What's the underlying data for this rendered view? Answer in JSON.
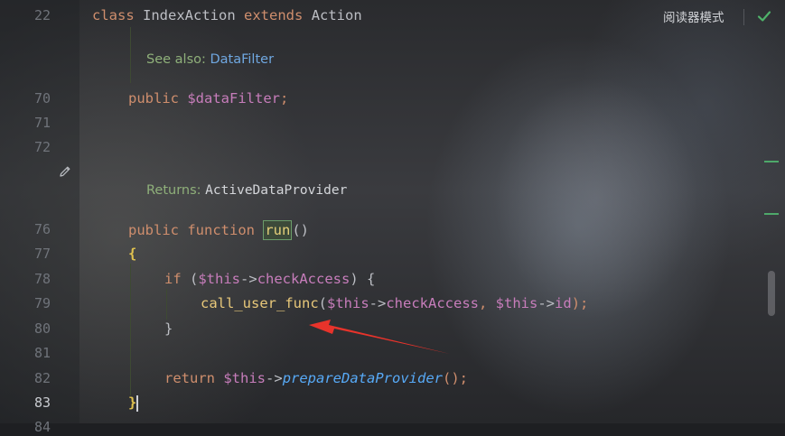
{
  "toolbar": {
    "reader_mode_label": "阅读器模式",
    "check_icon": "check-icon"
  },
  "editor": {
    "lines": {
      "l22": {
        "num": "22",
        "kw1": "class",
        "name": "IndexAction",
        "kw2": "extends",
        "parent": "Action"
      },
      "doc_see": {
        "label": "See also:",
        "link": "DataFilter"
      },
      "l70": {
        "num": "70",
        "kw": "public",
        "var": "$dataFilter",
        "semi": ";"
      },
      "l71": {
        "num": "71"
      },
      "l72": {
        "num": "72"
      },
      "doc_returns": {
        "label": "Returns:",
        "type": "ActiveDataProvider"
      },
      "l76": {
        "num": "76",
        "kw1": "public",
        "kw2": "function",
        "fn": "run",
        "parens": "()"
      },
      "l77": {
        "num": "77",
        "brace": "{"
      },
      "l78": {
        "num": "78",
        "kw": "if",
        "open": " (",
        "var": "$this",
        "arrow": "->",
        "prop": "checkAccess",
        "close": ") {"
      },
      "l79": {
        "num": "79",
        "fn": "call_user_func",
        "open": "(",
        "var1": "$this",
        "arrow1": "->",
        "prop1": "checkAccess",
        "comma": ", ",
        "var2": "$this",
        "arrow2": "->",
        "prop2": "id",
        "close": ");"
      },
      "l80": {
        "num": "80",
        "brace": "}"
      },
      "l81": {
        "num": "81"
      },
      "l82": {
        "num": "82",
        "kw": "return",
        "var": "$this",
        "arrow": "->",
        "call": "prepareDataProvider",
        "close": "();"
      },
      "l83": {
        "num": "83",
        "brace": "}"
      },
      "l84": {
        "num": "84"
      }
    }
  },
  "colors": {
    "keyword": "#cf8e6d",
    "variable": "#c77dbb",
    "function_decl": "#56a8f5",
    "function_call": "#e8c87a",
    "brace_match": "#e0c24f",
    "annotation_arrow": "#e8332b",
    "gutter_mark": "#4ea86a"
  }
}
